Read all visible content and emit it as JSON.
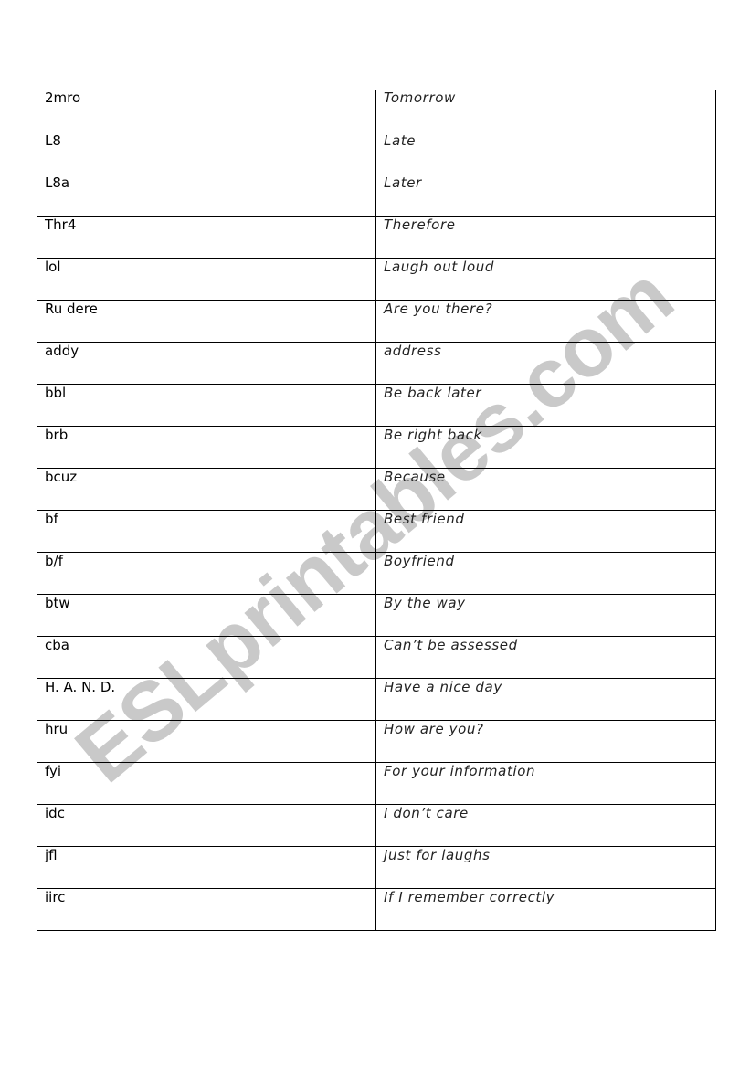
{
  "watermark": "ESLprintables.com",
  "rows": [
    {
      "abbr": "2mro",
      "meaning": "Tomorrow"
    },
    {
      "abbr": "L8",
      "meaning": "Late"
    },
    {
      "abbr": "L8a",
      "meaning": "Later"
    },
    {
      "abbr": "Thr4",
      "meaning": "Therefore"
    },
    {
      "abbr": "lol",
      "meaning": "Laugh out loud"
    },
    {
      "abbr": "Ru dere",
      "meaning": "Are you there?"
    },
    {
      "abbr": "addy",
      "meaning": "address"
    },
    {
      "abbr": "bbl",
      "meaning": "Be back later"
    },
    {
      "abbr": "brb",
      "meaning": "Be right back"
    },
    {
      "abbr": "bcuz",
      "meaning": "Because"
    },
    {
      "abbr": "bf",
      "meaning": "Best friend"
    },
    {
      "abbr": "b/f",
      "meaning": "Boyfriend"
    },
    {
      "abbr": "btw",
      "meaning": "By the way"
    },
    {
      "abbr": "cba",
      "meaning": "Can’t be assessed"
    },
    {
      "abbr": "H. A. N. D.",
      "meaning": "Have a nice day"
    },
    {
      "abbr": "hru",
      "meaning": "How are you?"
    },
    {
      "abbr": "fyi",
      "meaning": "For your information"
    },
    {
      "abbr": "idc",
      "meaning": "I don’t care"
    },
    {
      "abbr": "jfl",
      "meaning": "Just for laughs"
    },
    {
      "abbr": "iirc",
      "meaning": "If I remember correctly"
    }
  ]
}
